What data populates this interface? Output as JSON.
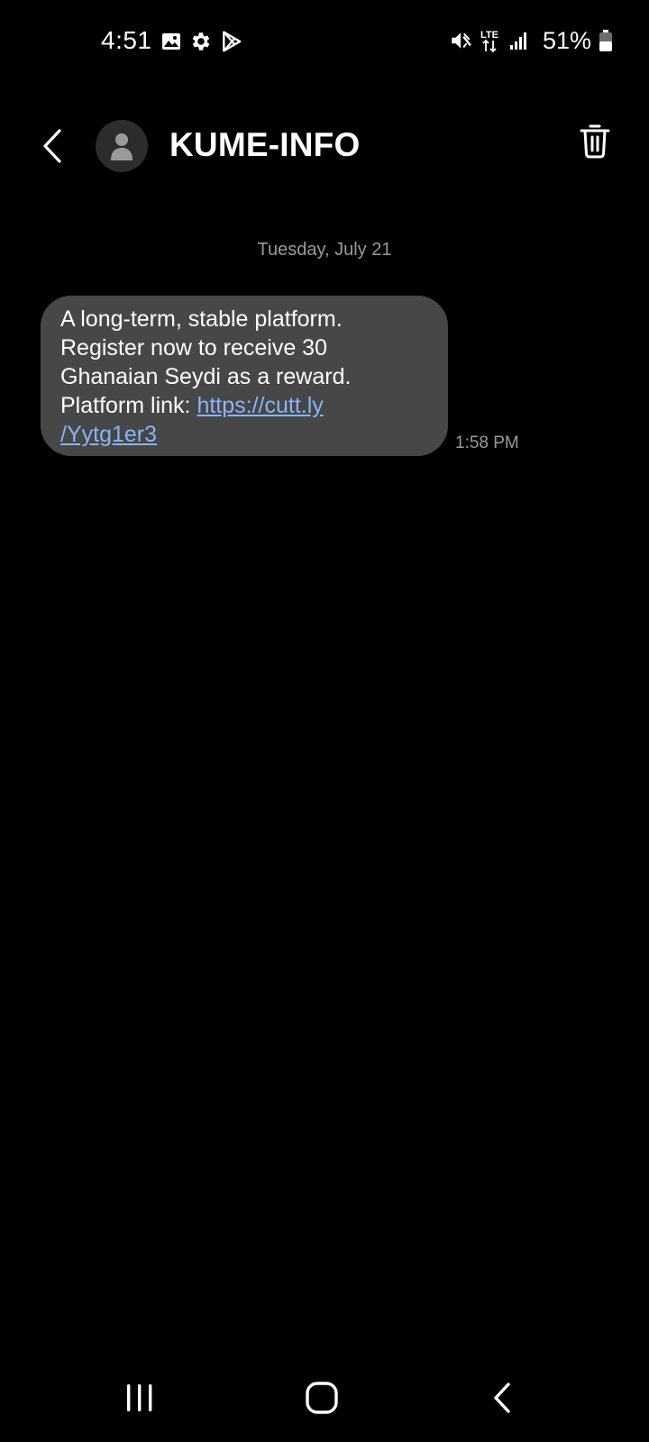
{
  "status_bar": {
    "time": "4:51",
    "battery": "51%",
    "left_icons": [
      "gallery-icon",
      "settings-icon",
      "play-store-icon"
    ],
    "right_icons": [
      "mute-icon",
      "lte-icon",
      "signal-icon",
      "battery-icon"
    ],
    "network_label": "LTE"
  },
  "header": {
    "contact_name": "KUME-INFO"
  },
  "conversation": {
    "date_divider": "Tuesday, July 21",
    "messages": [
      {
        "lines": [
          "A long-term, stable platform.",
          "Register now to receive 30",
          "Ghanaian Seydi as a reward.",
          "Platform link: "
        ],
        "link_part1": "https://cutt.ly",
        "link_part2": "/Yytg1er3",
        "time": "1:58 PM"
      }
    ]
  },
  "colors": {
    "background": "#000000",
    "bubble": "#474747",
    "link": "#8ab4f8",
    "secondary_text": "#9a9a9a"
  }
}
